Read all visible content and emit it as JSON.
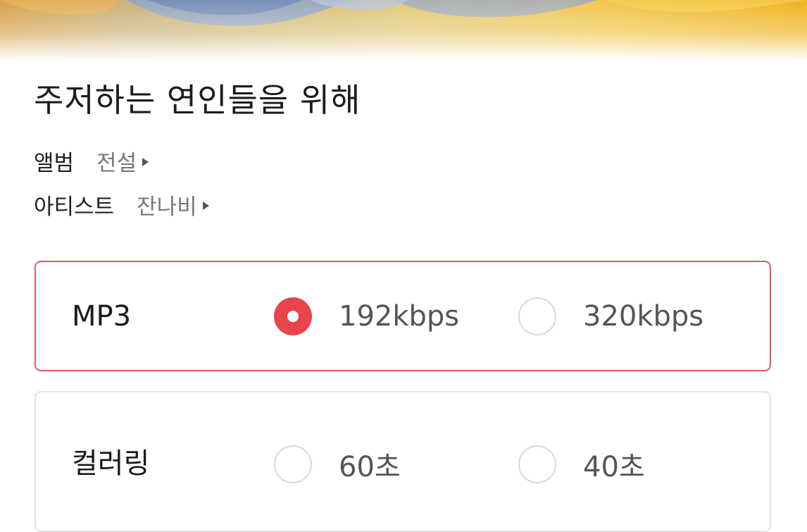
{
  "song": {
    "title": "주저하는 연인들을 위해",
    "album_label": "앨범",
    "album_name": "전설",
    "artist_label": "아티스트",
    "artist_name": "잔나비"
  },
  "download_options": {
    "mp3": {
      "label": "MP3",
      "options": [
        {
          "label": "192kbps",
          "selected": true
        },
        {
          "label": "320kbps",
          "selected": false
        }
      ]
    },
    "coloring": {
      "label": "컬러링",
      "options": [
        {
          "label": "60초",
          "selected": false
        },
        {
          "label": "40초",
          "selected": false
        }
      ]
    }
  },
  "colors": {
    "accent": "#e8444b",
    "card_border_selected": "#e8565d",
    "card_border": "#e2e2e2"
  }
}
